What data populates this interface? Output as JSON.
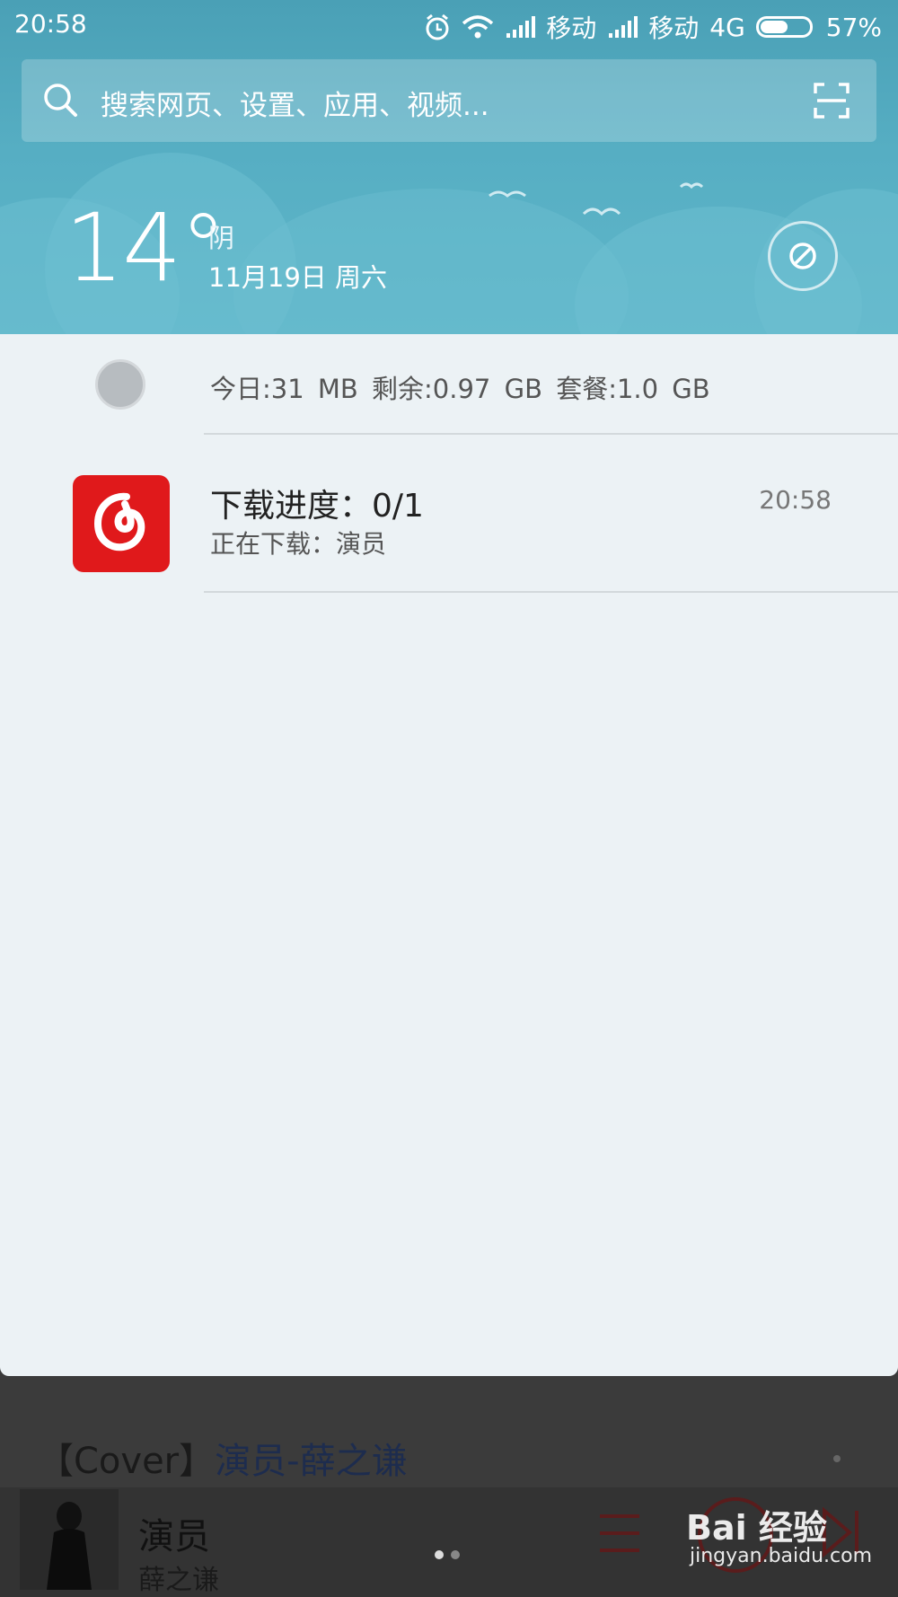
{
  "status_bar": {
    "time": "20:58",
    "carrier1": "移动",
    "carrier2": "移动",
    "network": "4G",
    "battery": "57%",
    "battery_level": 0.57
  },
  "search": {
    "placeholder": "搜索网页、设置、应用、视频..."
  },
  "weather": {
    "temperature": "14°",
    "condition": "阴",
    "date": "11月19日 周六"
  },
  "data_usage": {
    "today": "今日:31 MB",
    "remaining": "剩余:0.97 GB",
    "plan": "套餐:1.0 GB"
  },
  "notification": {
    "title": "下载进度：0/1",
    "subtitle": "正在下载：演员",
    "time": "20:58",
    "app_color": "#e0191b"
  },
  "background_app": {
    "song_prefix": "【Cover】",
    "song_title": "演员-薛之谦",
    "player_title": "演员",
    "player_artist": "薛之谦"
  },
  "watermark": {
    "brand": "Bai 经验",
    "url": "jingyan.baidu.com"
  }
}
